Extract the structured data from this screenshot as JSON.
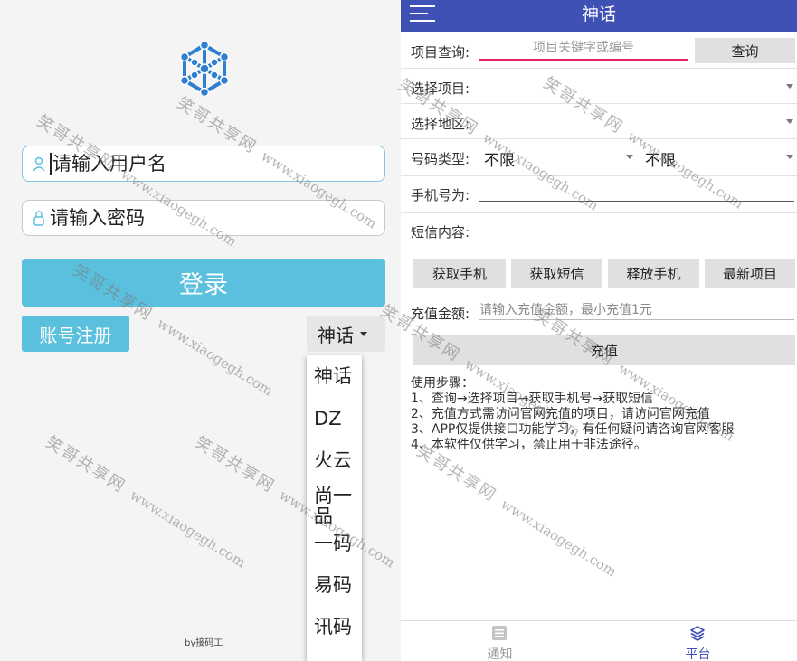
{
  "login": {
    "username_placeholder": "请输入用户名",
    "password_placeholder": "请输入密码",
    "login_label": "登录",
    "register_label": "账号注册",
    "platform_selected": "神话",
    "platform_options": [
      "神话",
      "DZ",
      "火云",
      "尚一品",
      "一码",
      "易码",
      "讯码"
    ],
    "footer": "by接码工"
  },
  "app": {
    "title": "神话",
    "query_label": "项目查询:",
    "query_placeholder": "项目关键字或编号",
    "query_button": "查询",
    "select_project_label": "选择项目:",
    "select_region_label": "选择地区:",
    "number_type_label": "号码类型:",
    "number_type_value1": "不限",
    "number_type_value2": "不限",
    "phone_label": "手机号为:",
    "sms_label": "短信内容:",
    "actions": [
      "获取手机",
      "获取短信",
      "释放手机",
      "最新项目"
    ],
    "recharge_label": "充值金额:",
    "recharge_placeholder": "请输入充值金额，最小充值1元",
    "recharge_button": "充值",
    "steps_title": "使用步骤：",
    "steps": [
      "1、查询→选择项目→获取手机号→获取短信",
      "2、充值方式需访问官网充值的项目，请访问官网充值",
      "3、APP仅提供接口功能学习，有任何疑问请咨询官网客服",
      "4、本软件仅供学习，禁止用于非法途径。"
    ],
    "nav": {
      "notice": "通知",
      "platform": "平台"
    }
  },
  "watermark": {
    "text": "笑哥共享网",
    "url": "www.xiaogegh.com"
  },
  "colors": {
    "accent": "#5bc0de",
    "topbar": "#3f51b5",
    "underline": "#e91e63"
  }
}
